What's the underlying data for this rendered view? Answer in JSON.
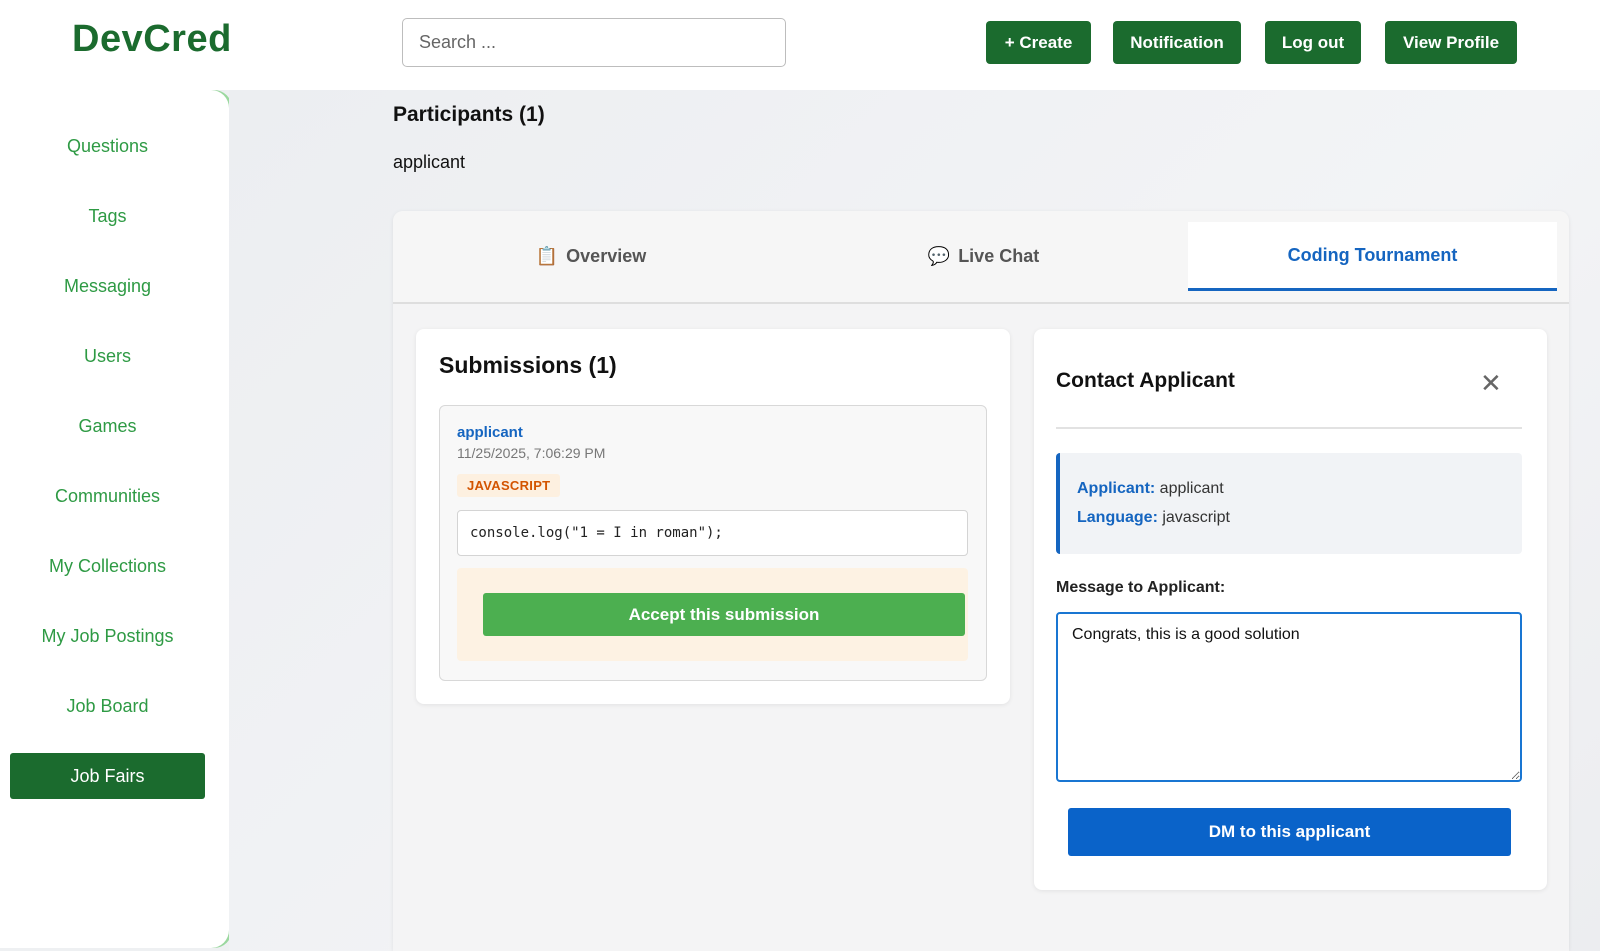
{
  "app": {
    "logo": "DevCred"
  },
  "header": {
    "search_placeholder": "Search ...",
    "buttons": {
      "create": "+ Create",
      "notification": "Notification",
      "logout": "Log out",
      "view_profile": "View Profile"
    }
  },
  "sidebar": {
    "items": [
      {
        "label": "Questions"
      },
      {
        "label": "Tags"
      },
      {
        "label": "Messaging"
      },
      {
        "label": "Users"
      },
      {
        "label": "Games"
      },
      {
        "label": "Communities"
      },
      {
        "label": "My Collections"
      },
      {
        "label": "My Job Postings"
      },
      {
        "label": "Job Board"
      },
      {
        "label": "Job Fairs",
        "active": true
      }
    ]
  },
  "participants": {
    "title": "Participants (1)",
    "names": [
      "applicant"
    ]
  },
  "tabs": [
    {
      "label": "Overview",
      "icon": "clipboard-icon",
      "glyph": "📋"
    },
    {
      "label": "Live Chat",
      "icon": "speech-bubble-icon",
      "glyph": "💬"
    },
    {
      "label": "Coding Tournament",
      "active": true
    }
  ],
  "submissions": {
    "title": "Submissions (1)",
    "items": [
      {
        "user": "applicant",
        "date": "11/25/2025, 7:06:29 PM",
        "language": "JAVASCRIPT",
        "code": "console.log(\"1 = I in roman\");",
        "accept_label": "Accept this submission"
      }
    ]
  },
  "contact": {
    "title": "Contact Applicant",
    "close_glyph": "✕",
    "applicant_key": "Applicant:",
    "applicant_value": "applicant",
    "language_key": "Language:",
    "language_value": "javascript",
    "message_label": "Message to Applicant:",
    "message_value": "Congrats, this is a good solution",
    "dm_label": "DM to this applicant"
  },
  "colors": {
    "brand_green": "#1b6b2e",
    "link_green": "#2e9a44",
    "accent_blue": "#1565c0",
    "accept_green": "#4caf50"
  }
}
